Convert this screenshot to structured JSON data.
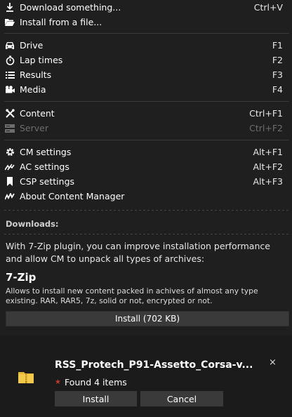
{
  "menu": {
    "download": {
      "label": "Download something...",
      "key": "Ctrl+V",
      "icon": "download-icon"
    },
    "install_file": {
      "label": "Install from a file...",
      "key": "",
      "icon": "folder-open-icon"
    },
    "drive": {
      "label": "Drive",
      "key": "F1",
      "icon": "car-icon"
    },
    "lap_times": {
      "label": "Lap times",
      "key": "F2",
      "icon": "stopwatch-icon"
    },
    "results": {
      "label": "Results",
      "key": "F3",
      "icon": "list-icon"
    },
    "media": {
      "label": "Media",
      "key": "F4",
      "icon": "camera-icon"
    },
    "content": {
      "label": "Content",
      "key": "Ctrl+F1",
      "icon": "tools-icon"
    },
    "server": {
      "label": "Server",
      "key": "Ctrl+F2",
      "icon": "server-icon"
    },
    "cm_settings": {
      "label": "CM settings",
      "key": "Alt+F1",
      "icon": "gear-icon"
    },
    "ac_settings": {
      "label": "AC settings",
      "key": "Alt+F2",
      "icon": "ac-logo-icon"
    },
    "csp_settings": {
      "label": "CSP settings",
      "key": "Alt+F3",
      "icon": "bookmark-icon"
    },
    "about": {
      "label": "About Content Manager",
      "key": "",
      "icon": "cm-logo-icon"
    }
  },
  "downloads": {
    "title": "Downloads:",
    "description": "With 7-Zip plugin, you can improve installation performance and allow CM to unpack all types of archives:",
    "plugin_name": "7-Zip",
    "plugin_description": "Allows to install new content packed in achives of almost any type existing. RAR, RAR5, 7z, solid or not, encrypted or not.",
    "install_label": "Install (702 KB)"
  },
  "toast": {
    "file_name": "RSS_Protech_P91-Assetto_Corsa-v...",
    "status": "Found 4 items",
    "install_label": "Install",
    "cancel_label": "Cancel",
    "close_glyph": "×",
    "star_glyph": "★"
  },
  "colors": {
    "background": "#1b1b1b",
    "button": "#3a3a3a",
    "disabled_text": "#6d6d6d",
    "folder": "#e8b938",
    "star": "#c0392b"
  }
}
